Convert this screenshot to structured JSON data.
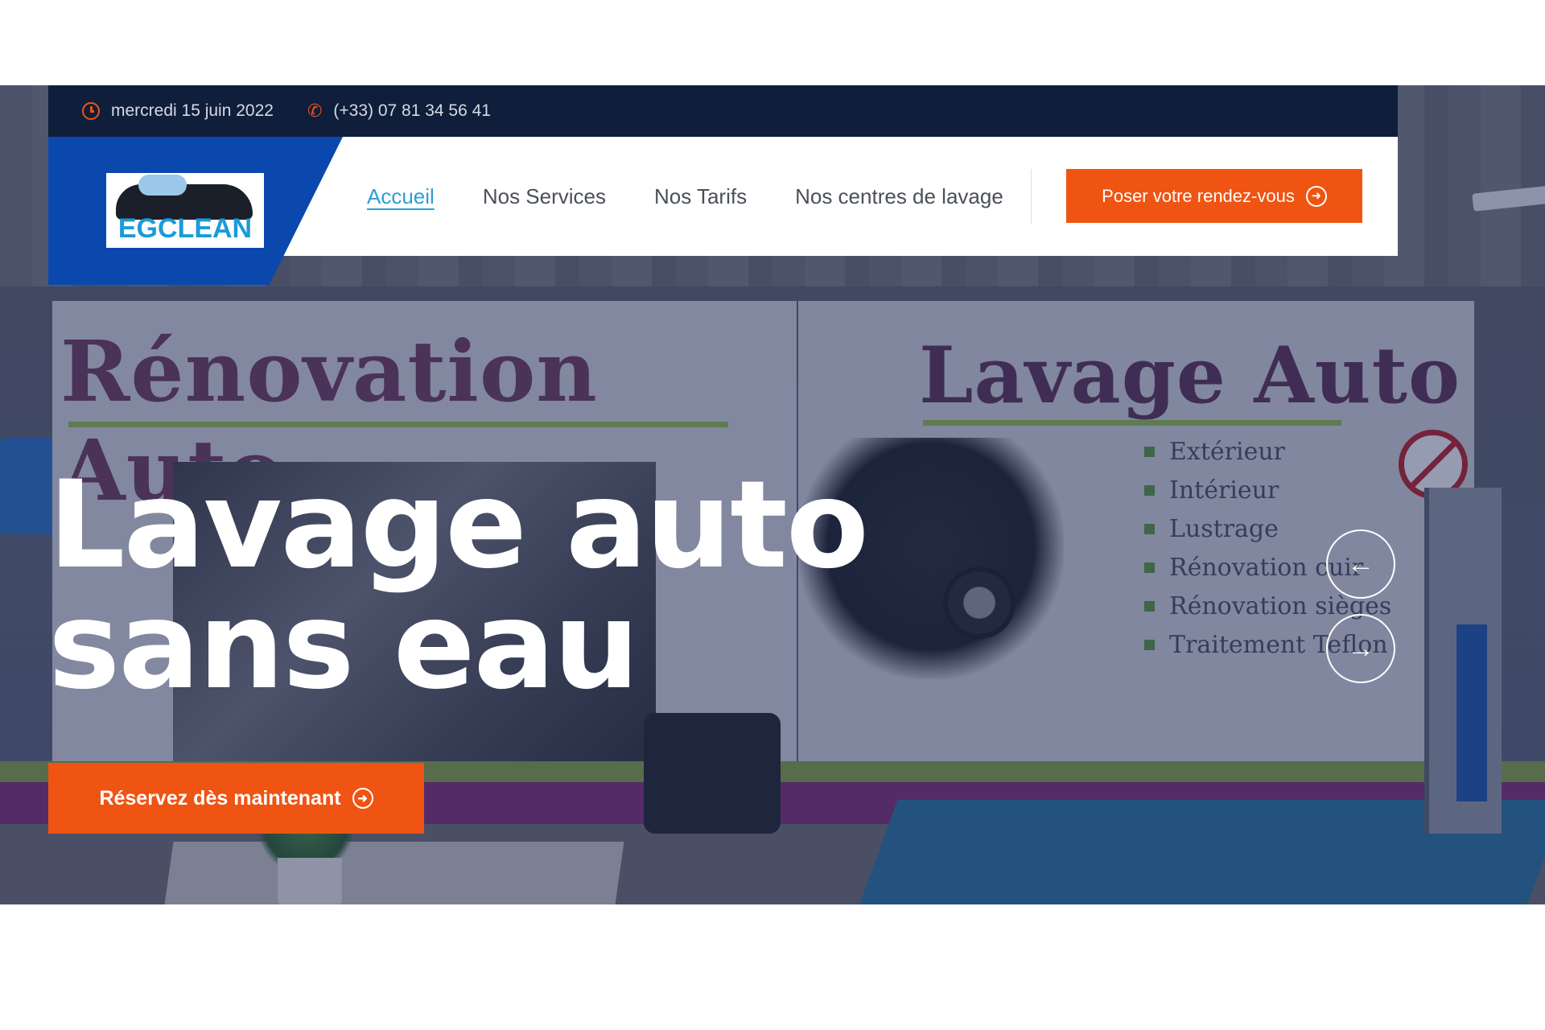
{
  "topbar": {
    "date": "mercredi 15 juin 2022",
    "phone": "(+33) 07 81 34 56 41",
    "date_icon": "clock-icon",
    "phone_icon": "phone-icon"
  },
  "logo": {
    "text": "EGCLEAN"
  },
  "nav": {
    "items": [
      {
        "label": "Accueil",
        "active": true
      },
      {
        "label": "Nos Services"
      },
      {
        "label": "Nos Tarifs"
      },
      {
        "label": "Nos centres de lavage"
      }
    ],
    "cta": "Poser votre rendez-vous"
  },
  "hero": {
    "title_line1": "Lavage auto",
    "title_line2": "sans eau",
    "cta": "Réservez dès maintenant",
    "prev_icon": "←",
    "next_icon": "→",
    "photo": {
      "sign_left": "Rénovation Auto",
      "sign_right": "Lavage Auto",
      "features": [
        "Extérieur",
        "Intérieur",
        "Lustrage",
        "Rénovation cuir",
        "Rénovation sièges",
        "Traitement Teflon"
      ]
    }
  },
  "colors": {
    "accent": "#ef5412",
    "topbar_bg": "#0f1e3b",
    "logo_bg": "#0a48ad",
    "active_link": "#2aa0d8"
  }
}
